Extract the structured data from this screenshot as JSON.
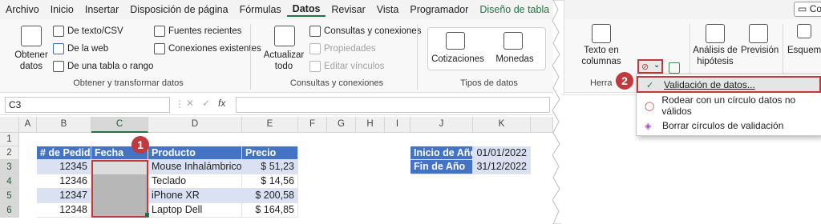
{
  "menu": {
    "tabs": [
      "Archivo",
      "Inicio",
      "Insertar",
      "Disposición de página",
      "Fórmulas",
      "Datos",
      "Revisar",
      "Vista",
      "Programador",
      "Diseño de tabla"
    ],
    "active_tab": "Datos",
    "right_button": "Co"
  },
  "ribbon": {
    "obtener": {
      "big_button": "Obtener datos",
      "items": [
        "De texto/CSV",
        "De la web",
        "De una tabla o rango",
        "Fuentes recientes",
        "Conexiones existentes"
      ],
      "label": "Obtener y transformar datos"
    },
    "consultas": {
      "big_button": "Actualizar todo",
      "items": [
        "Consultas y conexiones",
        "Propiedades",
        "Editar vínculos"
      ],
      "label": "Consultas y conexiones"
    },
    "tipos": {
      "items": [
        "Cotizaciones",
        "Monedas"
      ],
      "label": "Tipos de datos"
    },
    "herramientas": {
      "texto_columnas": "Texto en columnas",
      "label_partial": "Herra"
    },
    "prevision": {
      "analisis": "Análisis de hipótesis",
      "prevision": "Previsión"
    },
    "esquema": "Esquema"
  },
  "formula_bar": {
    "name_box": "C3",
    "fx": "fx"
  },
  "columns": [
    "A",
    "B",
    "C",
    "D",
    "E",
    "F",
    "G",
    "H",
    "I",
    "J",
    "K"
  ],
  "rows": [
    "1",
    "2",
    "3",
    "4",
    "5",
    "6"
  ],
  "table": {
    "headers": [
      "# de Pedido",
      "Fecha",
      "Producto",
      "Precio"
    ],
    "rows": [
      {
        "pedido": "12345",
        "fecha": "",
        "producto": "Mouse Inhalámbrico",
        "precio": "$ 51,23"
      },
      {
        "pedido": "12346",
        "fecha": "",
        "producto": "Teclado",
        "precio": "$ 14,56"
      },
      {
        "pedido": "12347",
        "fecha": "",
        "producto": "iPhone XR",
        "precio": "$ 200,58"
      },
      {
        "pedido": "12348",
        "fecha": "",
        "producto": "Laptop Dell",
        "precio": "$ 164,85"
      }
    ]
  },
  "dates": {
    "inicio_label": "Inicio de Año",
    "inicio_value": "01/01/2022",
    "fin_label": "Fin de Año",
    "fin_value": "31/12/2022"
  },
  "context_menu": {
    "items": [
      "Validación de datos...",
      "Rodear con un círculo datos no válidos",
      "Borrar círculos de validación"
    ]
  },
  "badges": [
    "1",
    "2"
  ],
  "colors": {
    "accent": "#217346",
    "table_header": "#4472c4",
    "band": "#d9e1f2",
    "highlight": "#c0393d"
  }
}
